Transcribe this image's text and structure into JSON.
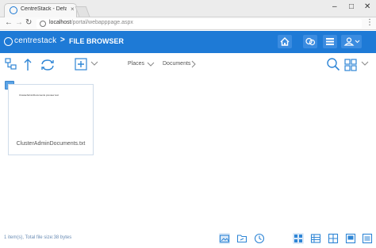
{
  "browser": {
    "tab_title": "CentreStack - Default Cl",
    "tab_close": "×",
    "url_host": "localhost",
    "url_path": "/portal/webapppage.aspx",
    "window_controls": {
      "minimize": "–",
      "maximize": "□",
      "close": "✕"
    }
  },
  "app": {
    "logo": "centrestack",
    "separator": ">",
    "title": "FILE BROWSER"
  },
  "breadcrumb": {
    "places": "Places",
    "documents": "Documents"
  },
  "files": [
    {
      "name": "ClusterAdminDocuments.txt",
      "preview": "ClusterAdminDocuments preview text"
    }
  ],
  "footer": {
    "status": "1 item(s), Total file size:38 bytes"
  },
  "colors": {
    "header_bg": "#1e7ad6",
    "accent": "#2f86d6",
    "status_text": "#6b8db5"
  }
}
